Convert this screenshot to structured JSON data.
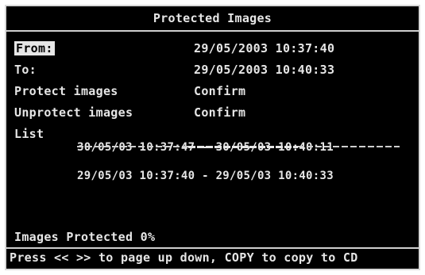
{
  "title": "Protected Images",
  "fields": {
    "from_label": "From:",
    "from_value": "29/05/2003 10:37:40",
    "to_label": "To:",
    "to_value": "29/05/2003 10:40:33",
    "protect_label": "Protect images",
    "protect_value": "Confirm",
    "unprotect_label": "Unprotect images",
    "unprotect_value": "Confirm",
    "list_label": "List"
  },
  "list_items": [
    "30/05/03 10:37:47 - 30/05/03 10:40:11",
    "29/05/03 10:37:40 - 29/05/03 10:40:33"
  ],
  "status": "Images Protected 0%",
  "help": "Press << >> to page up down, COPY to copy to CD"
}
